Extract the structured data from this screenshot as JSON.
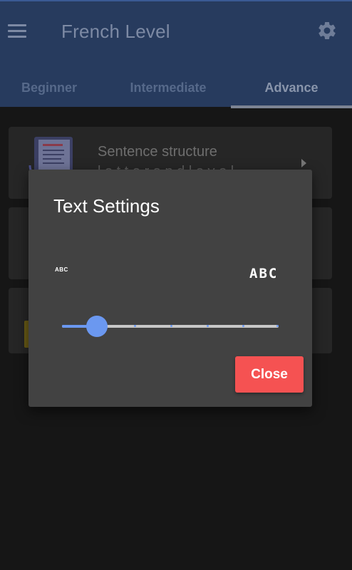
{
  "app": {
    "title": "French Level"
  },
  "tabs": [
    {
      "label": "Beginner",
      "active": false
    },
    {
      "label": "Intermediate",
      "active": false
    },
    {
      "label": "Advance",
      "active": true
    }
  ],
  "lessons": [
    {
      "title": "Sentence structure",
      "subtitle": "l e t t e r  a n d  l e v e l"
    }
  ],
  "dialog": {
    "title": "Text Settings",
    "small_sample": "ABC",
    "large_sample": "ABC",
    "slider": {
      "value_fraction": 0.16,
      "steps": 6
    },
    "close_label": "Close"
  },
  "colors": {
    "app_bar": "#273b5e",
    "accent": "#6b98f0",
    "close_button": "#f55252",
    "dialog_bg": "#424242"
  },
  "icons": [
    "menu-icon",
    "gear-icon",
    "document-scroll-icon",
    "chevron-right-icon"
  ]
}
